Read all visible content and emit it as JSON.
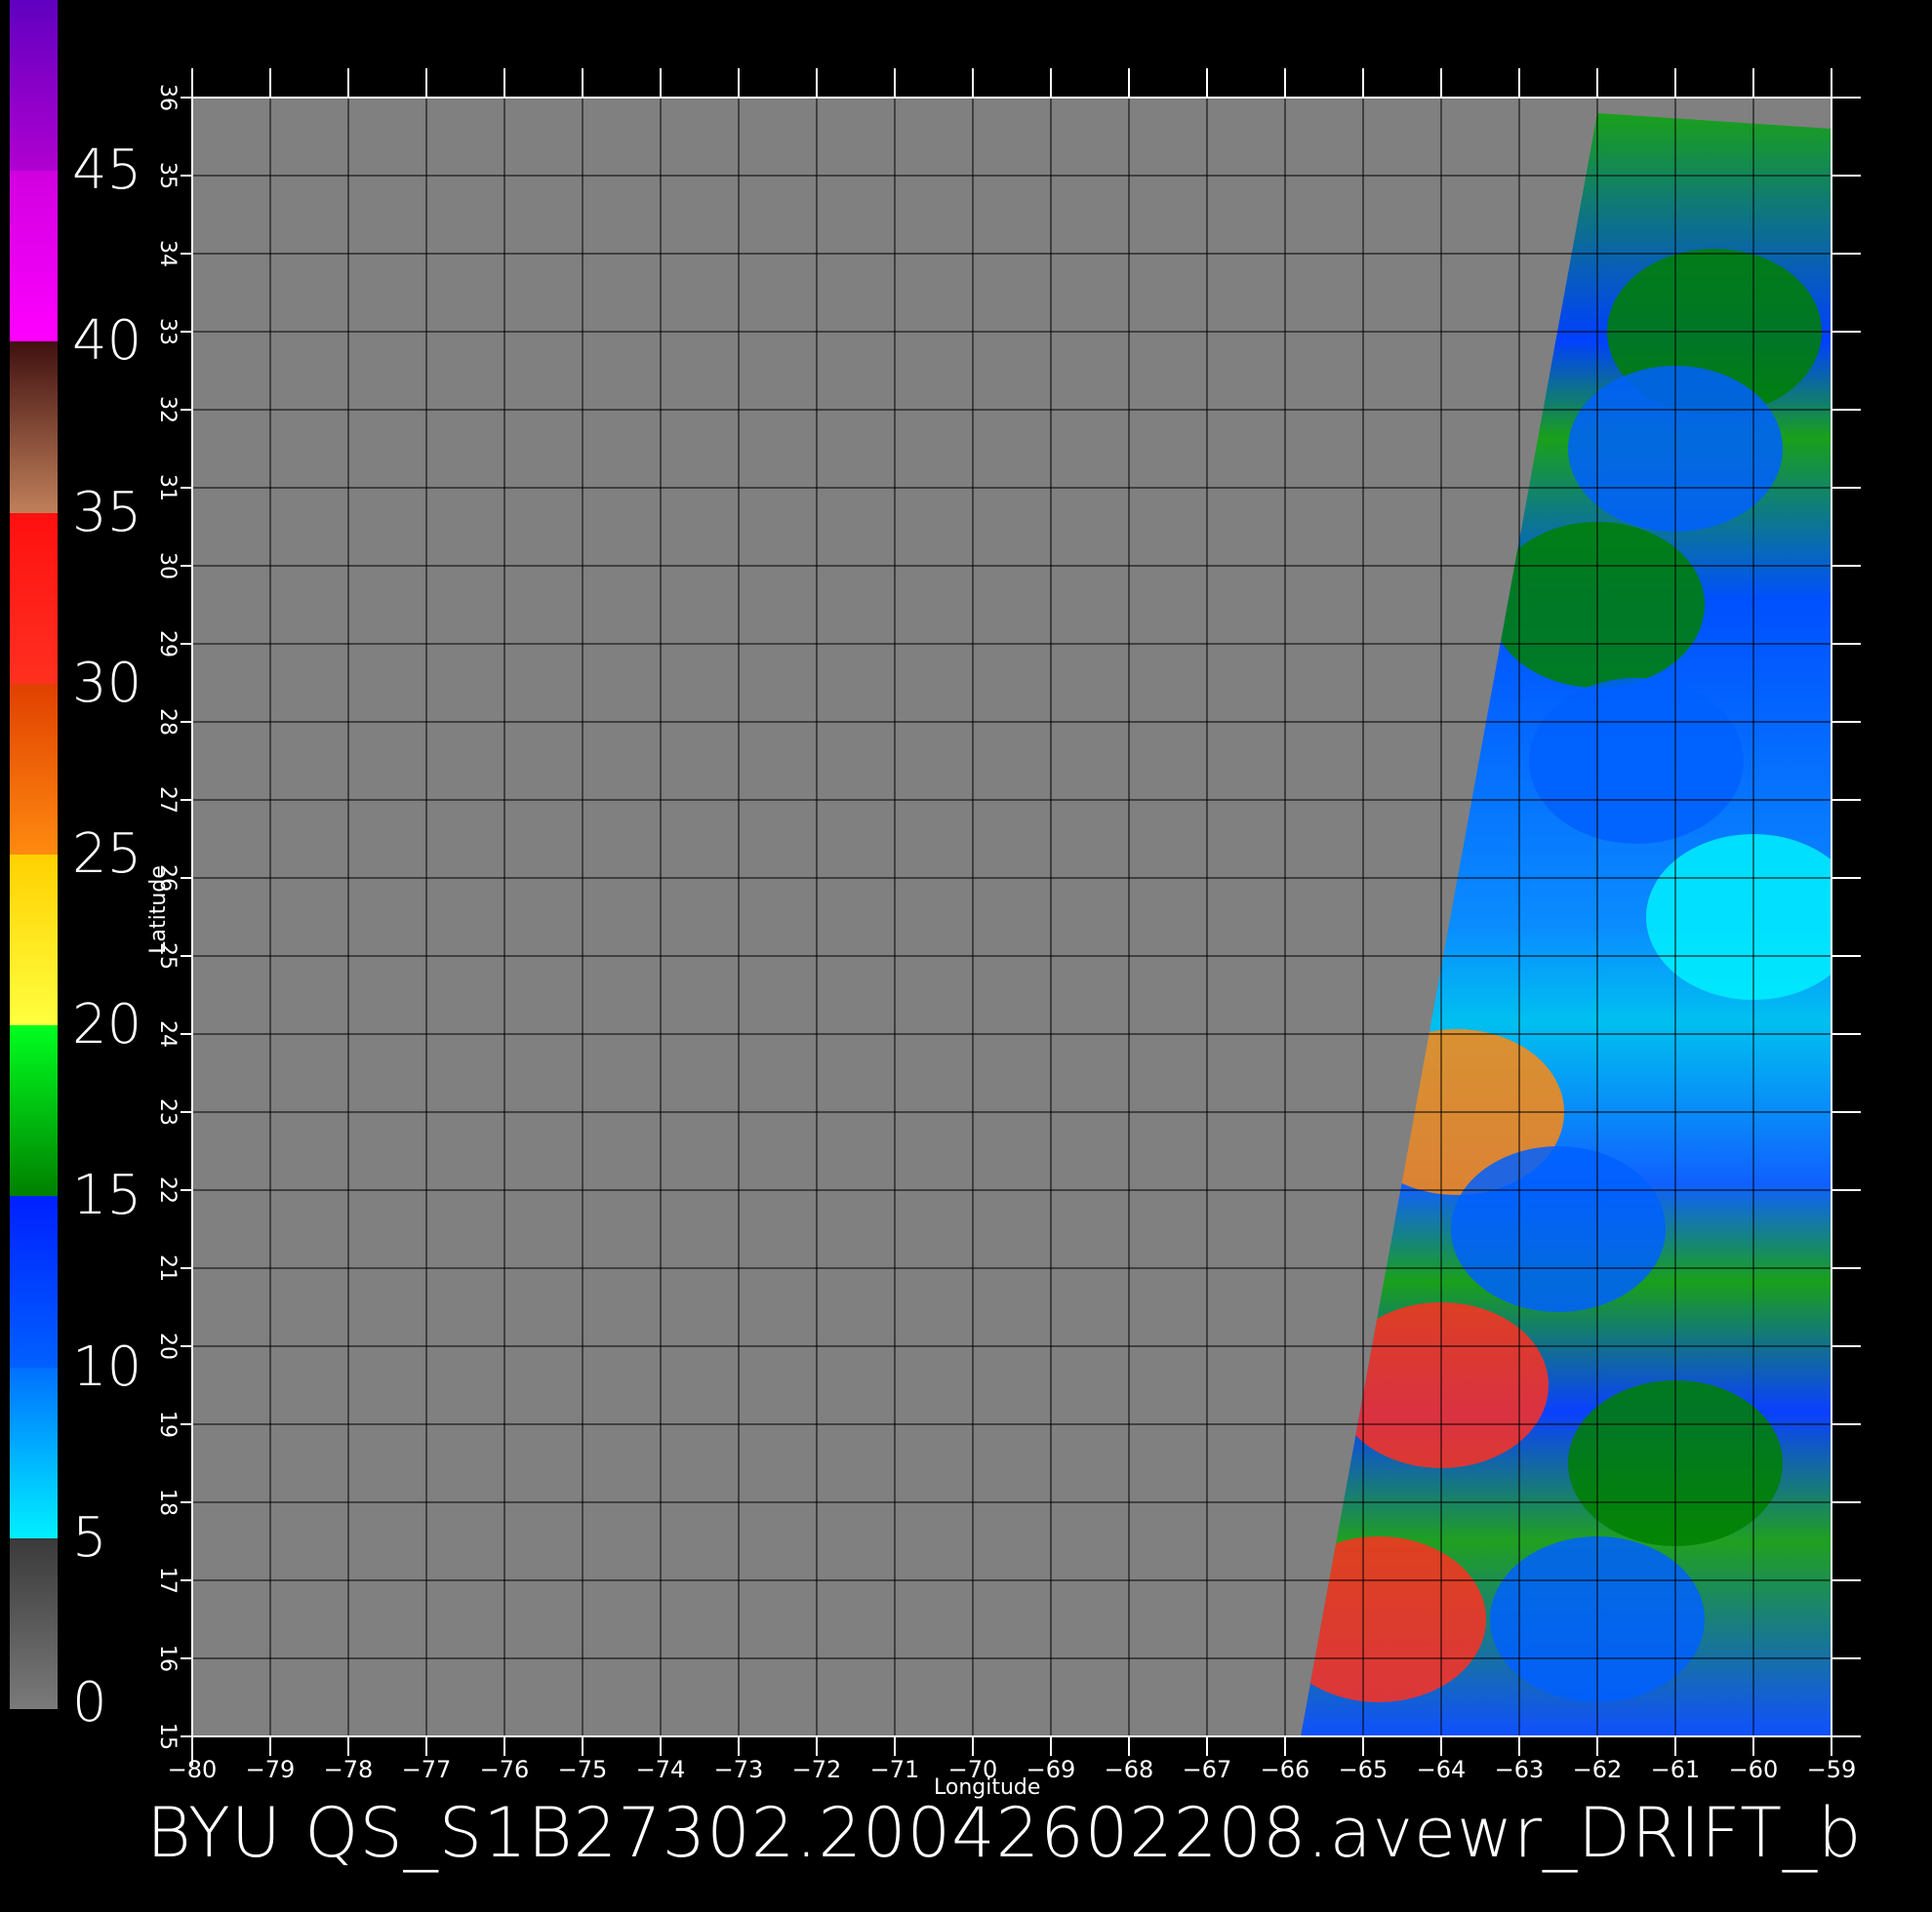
{
  "caption": "BYU QS_S1B27302.20042602208.avewr_DRIFT_b",
  "colorbar": {
    "labels": [
      "0",
      "5",
      "10",
      "15",
      "20",
      "25",
      "30",
      "35",
      "40",
      "45"
    ],
    "segments": [
      {
        "from": 0,
        "to": 5,
        "top": "#3a3a3a",
        "bottom": "#7a7a7a"
      },
      {
        "from": 5,
        "to": 10,
        "top": "#0070ff",
        "bottom": "#00f0ff"
      },
      {
        "from": 10,
        "to": 15,
        "top": "#0020ff",
        "bottom": "#0060ff"
      },
      {
        "from": 15,
        "to": 20,
        "top": "#00ff20",
        "bottom": "#008000"
      },
      {
        "from": 20,
        "to": 25,
        "top": "#ffd000",
        "bottom": "#ffff40"
      },
      {
        "from": 25,
        "to": 30,
        "top": "#e04000",
        "bottom": "#ff8a10"
      },
      {
        "from": 30,
        "to": 35,
        "top": "#ff1010",
        "bottom": "#ff3020"
      },
      {
        "from": 35,
        "to": 40,
        "top": "#401010",
        "bottom": "#c0805a"
      },
      {
        "from": 40,
        "to": 45,
        "top": "#d000e0",
        "bottom": "#ff00ff"
      },
      {
        "from": 45,
        "to": 50,
        "top": "#6000c0",
        "bottom": "#b000d0"
      }
    ]
  },
  "chart_data": {
    "type": "heatmap",
    "xlabel": "Longitude",
    "ylabel": "Latitude",
    "xlim": [
      -80,
      -59
    ],
    "ylim": [
      15,
      36
    ],
    "xticks": [
      "-80",
      "-79",
      "-78",
      "-77",
      "-76",
      "-75",
      "-74",
      "-73",
      "-72",
      "-71",
      "-70",
      "-69",
      "-68",
      "-67",
      "-66",
      "-65",
      "-64",
      "-63",
      "-62",
      "-61",
      "-60",
      "-59"
    ],
    "yticks": [
      "15",
      "16",
      "17",
      "18",
      "19",
      "20",
      "21",
      "22",
      "23",
      "24",
      "25",
      "26",
      "27",
      "28",
      "29",
      "30",
      "31",
      "32",
      "33",
      "34",
      "35",
      "36"
    ],
    "grid": true,
    "background": "#808080",
    "swath": {
      "corners_lonlat": [
        [
          -62.0,
          35.8
        ],
        [
          -59.0,
          35.6
        ],
        [
          -59.0,
          15.0
        ],
        [
          -65.8,
          15.0
        ]
      ]
    },
    "wind_speed_regions": [
      {
        "lon": -60.5,
        "lat": 33.0,
        "speed": 17
      },
      {
        "lon": -61.0,
        "lat": 31.5,
        "speed": 12
      },
      {
        "lon": -62.0,
        "lat": 29.5,
        "speed": 17
      },
      {
        "lon": -61.5,
        "lat": 27.5,
        "speed": 11
      },
      {
        "lon": -60.0,
        "lat": 25.5,
        "speed": 7
      },
      {
        "lon": -63.8,
        "lat": 23.0,
        "speed": 28
      },
      {
        "lon": -62.5,
        "lat": 21.5,
        "speed": 14
      },
      {
        "lon": -64.0,
        "lat": 19.5,
        "speed": 30
      },
      {
        "lon": -61.0,
        "lat": 18.5,
        "speed": 18
      },
      {
        "lon": -64.8,
        "lat": 16.5,
        "speed": 31
      },
      {
        "lon": -62.0,
        "lat": 16.5,
        "speed": 12
      }
    ]
  }
}
